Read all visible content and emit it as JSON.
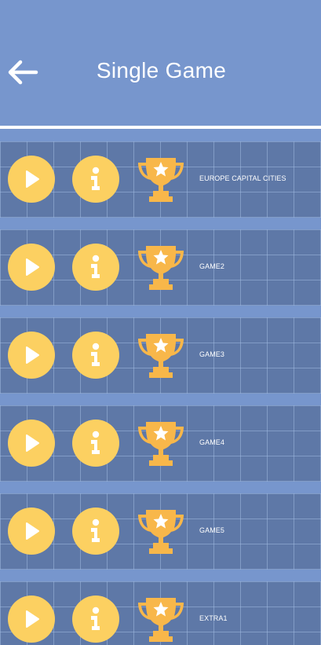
{
  "header": {
    "title": "Single Game",
    "back_icon": "arrow-left-icon"
  },
  "colors": {
    "background": "#7796cd",
    "row": "#5e78a7",
    "accent": "#fcd061",
    "trophy": "#f8b74a",
    "text": "#ffffff"
  },
  "games": [
    {
      "name": "EUROPE CAPITAL CITIES"
    },
    {
      "name": "GAME2"
    },
    {
      "name": "GAME3"
    },
    {
      "name": "GAME4"
    },
    {
      "name": "GAME5"
    },
    {
      "name": "EXTRA1"
    }
  ],
  "row_icons": {
    "play": "play-icon",
    "info": "info-icon",
    "trophy": "trophy-icon"
  }
}
